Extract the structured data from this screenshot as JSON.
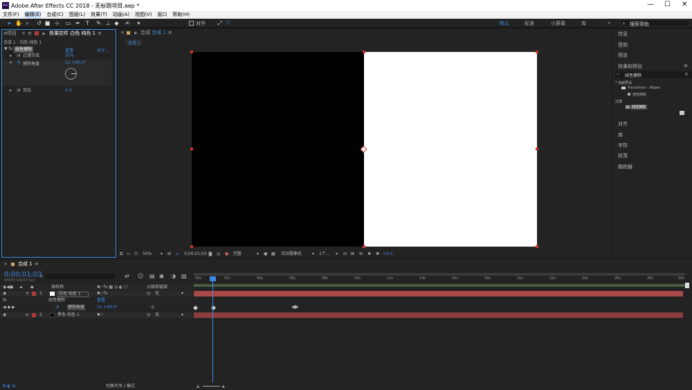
{
  "title_bar": {
    "title": "Adobe After Effects CC 2018 - 无标题项目.aep *"
  },
  "menu": {
    "items": [
      "文件(F)",
      "编辑(E)",
      "合成(C)",
      "图层(L)",
      "效果(T)",
      "动画(A)",
      "视图(V)",
      "窗口",
      "帮助(H)"
    ]
  },
  "toolbar": {
    "align_label": "对齐",
    "workspaces": [
      "默认",
      "标准",
      "小屏幕",
      "库"
    ],
    "search_placeholder": "搜索帮助"
  },
  "effects_panel": {
    "tab_project": "项目",
    "tab_effects": "效果控件 白色 纯色 1",
    "breadcrumb": "合成 1 · 白色 纯色 1",
    "effect_name": "线性擦除",
    "reset": "重置",
    "about": "关于...",
    "props": [
      {
        "label": "过渡完成",
        "value": "50%"
      },
      {
        "label": "擦除角度",
        "value": "1x +90.0°"
      },
      {
        "label": "羽化",
        "value": "0.0"
      }
    ]
  },
  "comp_panel": {
    "tab": "合成 1",
    "subtab": "合成 1",
    "zoom": "50%",
    "timecode": "0;00;01;03",
    "resolution": "完整",
    "camera": "活动摄像机",
    "views": "1个...",
    "exposure": "+0.0"
  },
  "right_panel": {
    "items": [
      "信息",
      "音频",
      "预览",
      "效果和预设"
    ],
    "search_value": "线性擦除",
    "preset_folder": "* 动画预设",
    "preset_sub": "Transitions - Wipes",
    "preset_item": "线性擦除",
    "category": "过渡",
    "effect_item": "线性擦除",
    "lower_items": [
      "对齐",
      "库",
      "字符",
      "段落",
      "跟踪器"
    ]
  },
  "timeline": {
    "tab": "合成 1",
    "timecode": "0;00;01;03",
    "fps": "00033 (29.97 fps)",
    "col_name": "源名称",
    "col_parent": "父级和链接",
    "ruler": [
      "00s",
      "02s",
      "04s",
      "06s",
      "08s",
      "10s",
      "12s",
      "14s",
      "16s",
      "18s",
      "20s",
      "22s",
      "24s",
      "26s",
      "28s",
      "30s"
    ],
    "layers": [
      {
        "num": "1",
        "name": "白色 纯色 1",
        "parent": "无"
      },
      {
        "num": "2",
        "name": "黑色 纯色 1",
        "parent": "无"
      }
    ],
    "effect_row": "线性擦除",
    "effect_reset": "重置",
    "sub_prop": "擦除角度",
    "sub_value": "1x +90.0°",
    "footer": "切换开关 / 模式"
  },
  "colors": {
    "accent": "#3c8ae0",
    "layer_bar": "#a84848",
    "panel_bg": "#232323"
  }
}
